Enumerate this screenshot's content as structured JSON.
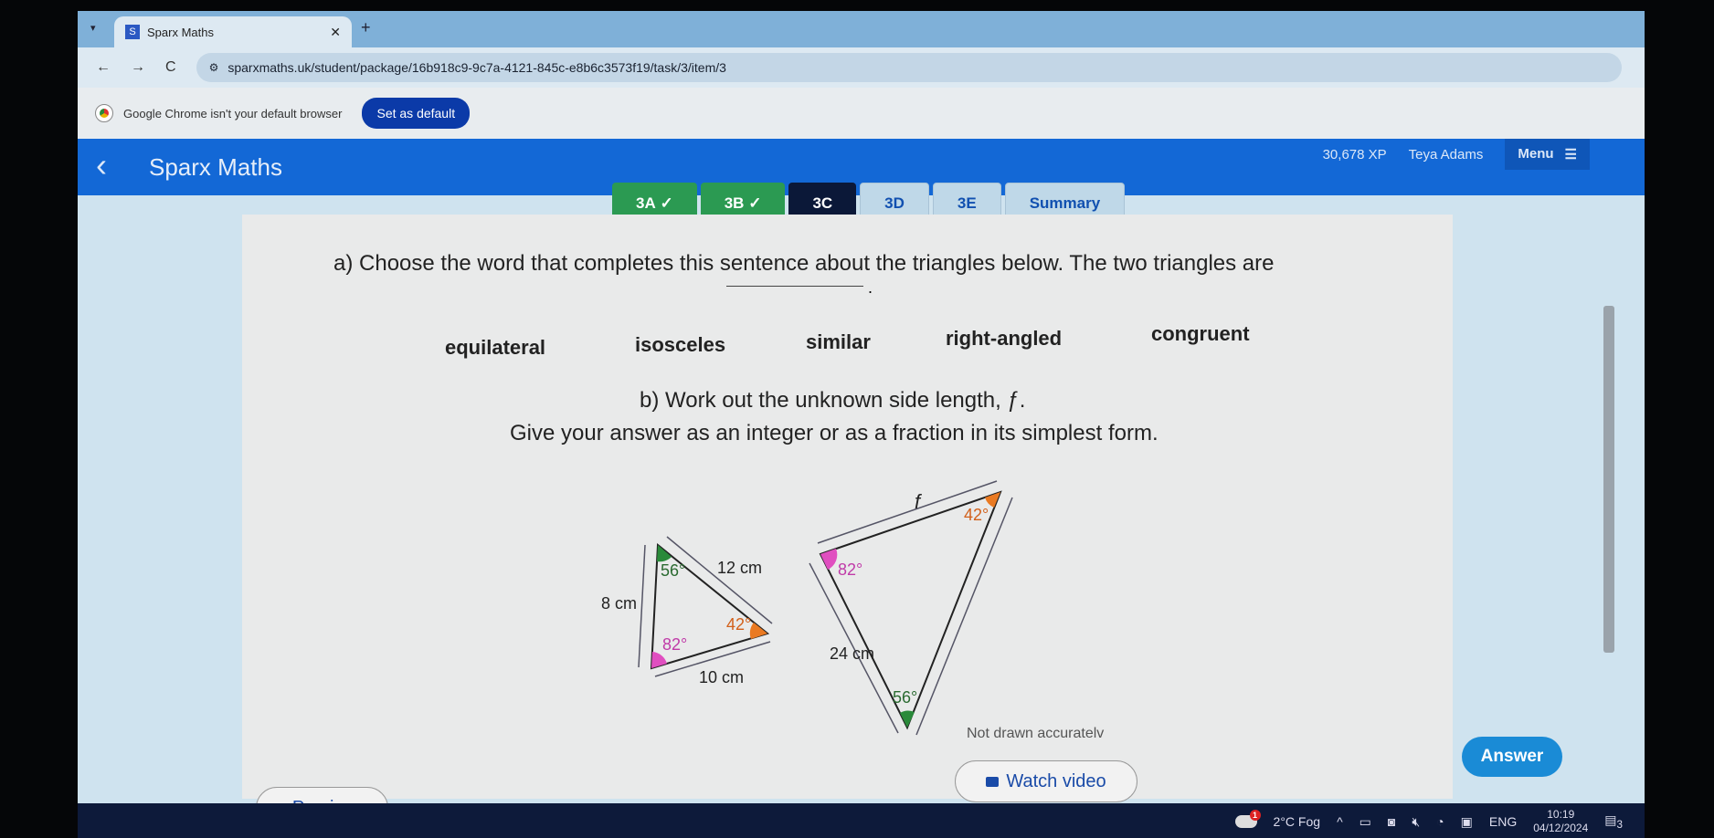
{
  "browser": {
    "tab_title": "Sparx Maths",
    "tab_favicon": "S",
    "url": "sparxmaths.uk/student/package/16b918c9-9c7a-4121-845c-e8b6c3573f19/task/3/item/3",
    "infobar_text": "Google Chrome isn't your default browser",
    "set_default_label": "Set as default"
  },
  "header": {
    "title": "Sparx Maths",
    "xp": "30,678 XP",
    "user": "Teya Adams",
    "menu_label": "Menu"
  },
  "tasks": [
    {
      "label": "3A",
      "status": "complete"
    },
    {
      "label": "3B",
      "status": "complete"
    },
    {
      "label": "3C",
      "status": "current"
    },
    {
      "label": "3D",
      "status": "todo"
    },
    {
      "label": "3E",
      "status": "todo"
    },
    {
      "label": "Summary",
      "status": "todo"
    }
  ],
  "question": {
    "part_a": "a) Choose the word that completes this sentence about the triangles below. The two triangles are",
    "options": [
      "equilateral",
      "isosceles",
      "similar",
      "right-angled",
      "congruent"
    ],
    "part_b": "b) Work out the unknown side length, ƒ.",
    "instruction": "Give your answer as an integer or as a fraction in its simplest form.",
    "figure": {
      "small": {
        "angles": [
          "56°",
          "82°",
          "42°"
        ],
        "sides": [
          "8 cm",
          "12 cm",
          "10 cm"
        ]
      },
      "large": {
        "angles": [
          "82°",
          "42°",
          "56°"
        ],
        "sides": [
          "f",
          "24 cm"
        ]
      },
      "note": "Not drawn accuratelv",
      "colors": {
        "green": "#2a8a3a",
        "pink": "#e04fc0",
        "orange": "#ea7a22"
      }
    }
  },
  "buttons": {
    "watch_video": "Watch video",
    "answer": "Answer",
    "previous": "Previous"
  },
  "taskbar": {
    "weather": "2°C Fog",
    "weather_badge": "1",
    "language": "ENG",
    "time": "10:19",
    "date": "04/12/2024",
    "notifications": "3"
  }
}
